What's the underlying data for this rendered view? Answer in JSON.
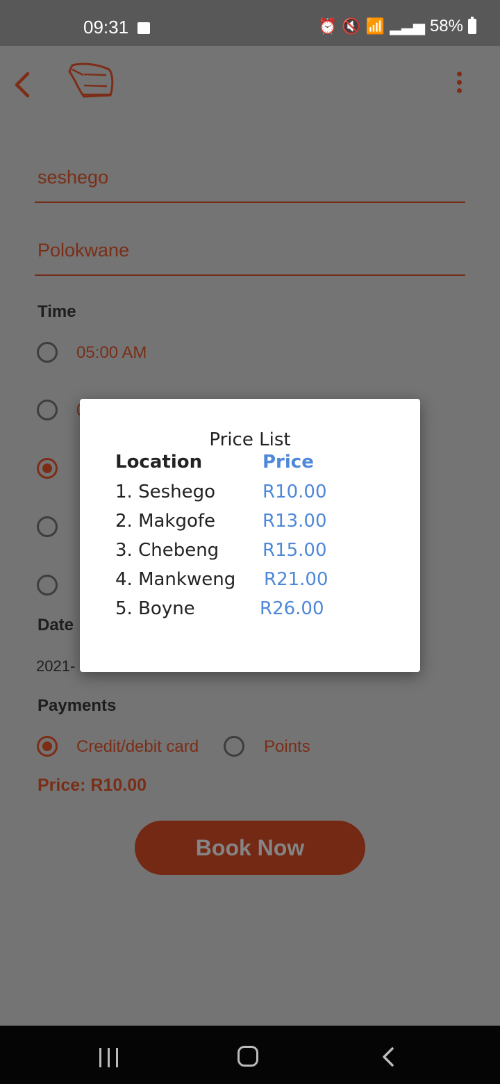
{
  "statusbar": {
    "time": "09:31",
    "battery": "58%",
    "icons": [
      "gallery-icon",
      "alarm-icon",
      "mute-icon",
      "wifi-icon",
      "signal-icon",
      "battery-icon"
    ]
  },
  "appbar": {
    "back_icon": "back-chevron-icon",
    "logo_icon": "bus-logo-icon",
    "menu_icon": "kebab-menu-icon"
  },
  "form": {
    "from": "seshego",
    "to": "Polokwane",
    "time_label": "Time",
    "time_options": [
      {
        "label": "05:00 AM",
        "selected": false
      },
      {
        "label": "0",
        "selected": false
      },
      {
        "label": "",
        "selected": true
      },
      {
        "label": "",
        "selected": false
      },
      {
        "label": "",
        "selected": false
      }
    ],
    "date_label": "Date",
    "date_value": "2021-",
    "payments_label": "Payments",
    "payment_options": [
      {
        "label": "Credit/debit card",
        "selected": true
      },
      {
        "label": "Points",
        "selected": false
      }
    ],
    "price": "Price: R10.00",
    "book_button": "Book Now"
  },
  "modal": {
    "title": "Price List",
    "location_header": "Location",
    "price_header": "Price",
    "rows": [
      {
        "location": "1. Seshego",
        "price": "R10.00"
      },
      {
        "location": "2. Makgofe",
        "price": "R13.00"
      },
      {
        "location": "3. Chebeng",
        "price": "R15.00"
      },
      {
        "location": "4. Mankweng",
        "price": "R21.00"
      },
      {
        "location": "5. Boyne",
        "price": "R26.00"
      }
    ]
  },
  "navbar": {
    "recent": "recent-apps-icon",
    "home": "home-icon",
    "back": "back-icon"
  }
}
